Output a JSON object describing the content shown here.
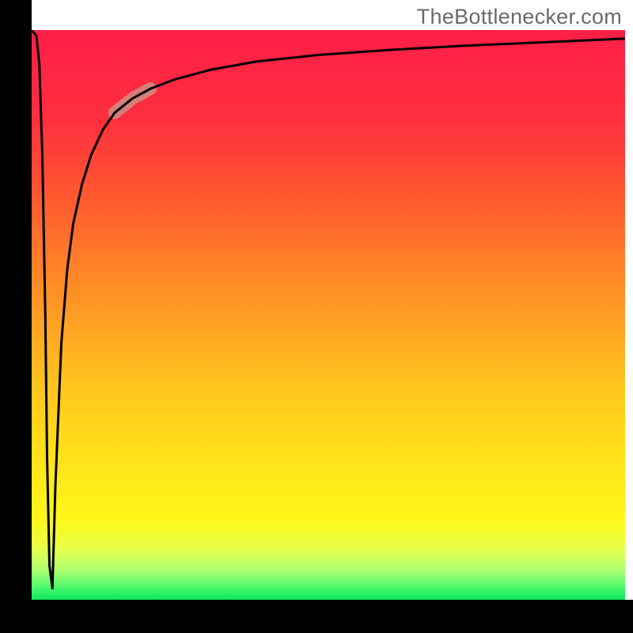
{
  "watermark": {
    "text": "TheBottlenecker.com"
  },
  "chart_data": {
    "type": "line",
    "title": "",
    "xlabel": "",
    "ylabel": "",
    "xlim": [
      0,
      100
    ],
    "ylim": [
      0,
      100
    ],
    "grid": false,
    "legend": false,
    "background": {
      "direction": "vertical",
      "stops": [
        {
          "pos": 0.0,
          "color": "#ff1f47"
        },
        {
          "pos": 0.16,
          "color": "#ff2f3f"
        },
        {
          "pos": 0.3,
          "color": "#ff5b2f"
        },
        {
          "pos": 0.45,
          "color": "#ff8c25"
        },
        {
          "pos": 0.62,
          "color": "#ffc31e"
        },
        {
          "pos": 0.75,
          "color": "#ffe21a"
        },
        {
          "pos": 0.86,
          "color": "#fff71a"
        },
        {
          "pos": 0.91,
          "color": "#e7ff49"
        },
        {
          "pos": 0.95,
          "color": "#aaff72"
        },
        {
          "pos": 0.98,
          "color": "#45f96b"
        },
        {
          "pos": 1.0,
          "color": "#0de65f"
        }
      ]
    },
    "series": [
      {
        "name": "bottleneck-curve",
        "color": "#000000",
        "stroke_width": 3,
        "x": [
          0.0,
          0.8,
          1.3,
          1.8,
          2.3,
          2.6,
          3.0,
          3.5,
          4.0,
          5.0,
          6.0,
          7.0,
          8.5,
          10.0,
          12.0,
          14.0,
          17.0,
          20.0,
          24.0,
          30.0,
          38.0,
          48.0,
          60.0,
          72.0,
          85.0,
          100.0
        ],
        "y": [
          100.0,
          99.0,
          94.0,
          78.0,
          50.0,
          25.0,
          6.0,
          2.0,
          20.0,
          45.0,
          58.0,
          66.0,
          73.0,
          78.0,
          82.5,
          85.5,
          88.0,
          89.7,
          91.3,
          93.0,
          94.5,
          95.6,
          96.5,
          97.2,
          97.8,
          98.5
        ]
      }
    ],
    "highlight": {
      "series": "bottleneck-curve",
      "x_range": [
        13.0,
        20.0
      ],
      "color": "#d0887e",
      "width": 16
    }
  }
}
